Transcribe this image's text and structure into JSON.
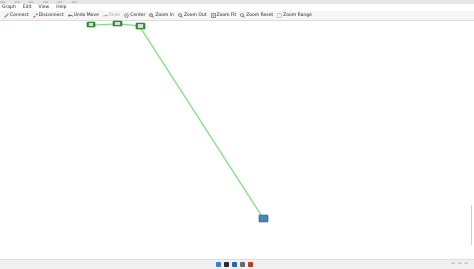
{
  "window": {
    "title_fragments": [
      "xxx",
      "xxx",
      "xxx",
      "xxx",
      "xxx",
      "xxx"
    ]
  },
  "menu": {
    "items": [
      "Graph",
      "Edit",
      "View",
      "Help"
    ]
  },
  "toolbar": {
    "connect": "Connect",
    "disconnect": "Disconnect",
    "undo_move": "Undo Move",
    "redo": "Redo",
    "center": "Center",
    "zoom_in": "Zoom In",
    "zoom_out": "Zoom Out",
    "zoom_fit": "Zoom Fit",
    "zoom_reset": "Zoom Reset",
    "zoom_range": "Zoom Range"
  },
  "colors": {
    "edge": "#7fe07f",
    "node_green": "#3c9a3c",
    "node_blue": "#4a86c4",
    "taskbar_icons": [
      "#3b7fd4",
      "#2a2a2a",
      "#1f6ab5",
      "#6a6a6a",
      "#c0392b"
    ]
  },
  "icons": [
    "connect-icon",
    "disconnect-icon",
    "undo-icon",
    "redo-icon",
    "center-icon",
    "zoom-in-icon",
    "zoom-out-icon",
    "zoom-fit-icon",
    "zoom-reset-icon",
    "zoom-range-icon"
  ],
  "tray": {
    "items": [
      "xx",
      "xx",
      "xx"
    ]
  }
}
